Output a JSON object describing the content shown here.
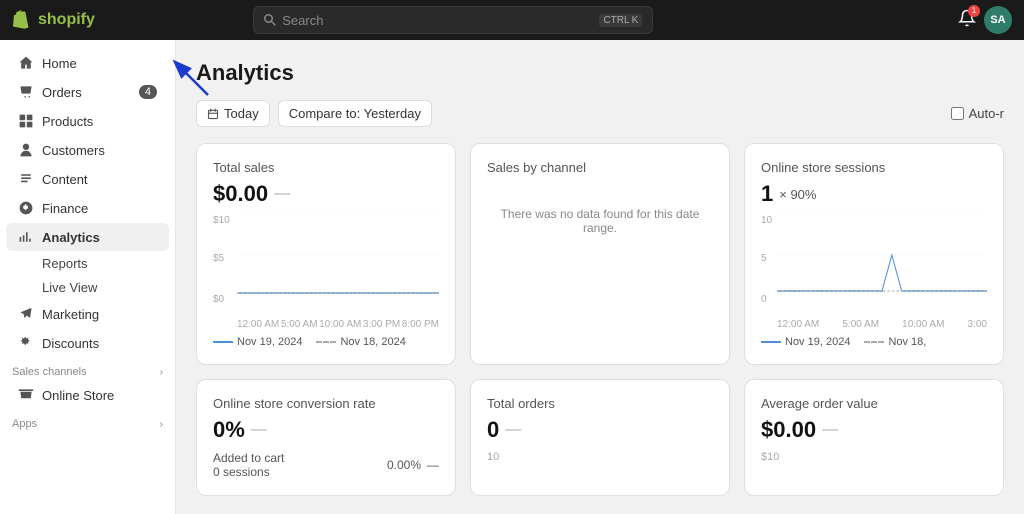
{
  "topbar": {
    "logo_text": "shopify",
    "search_placeholder": "Search",
    "kbd_ctrl": "CTRL",
    "kbd_k": "K",
    "notif_count": "1",
    "avatar_text": "SA"
  },
  "sidebar": {
    "items": [
      {
        "id": "home",
        "label": "Home",
        "icon": "home"
      },
      {
        "id": "orders",
        "label": "Orders",
        "icon": "orders",
        "badge": "4"
      },
      {
        "id": "products",
        "label": "Products",
        "icon": "products"
      },
      {
        "id": "customers",
        "label": "Customers",
        "icon": "customers"
      },
      {
        "id": "content",
        "label": "Content",
        "icon": "content"
      },
      {
        "id": "finance",
        "label": "Finance",
        "icon": "finance"
      },
      {
        "id": "analytics",
        "label": "Analytics",
        "icon": "analytics",
        "active": true
      },
      {
        "id": "marketing",
        "label": "Marketing",
        "icon": "marketing"
      },
      {
        "id": "discounts",
        "label": "Discounts",
        "icon": "discounts"
      }
    ],
    "analytics_sub": [
      {
        "id": "reports",
        "label": "Reports"
      },
      {
        "id": "live-view",
        "label": "Live View"
      }
    ],
    "sales_channels_label": "Sales channels",
    "apps_label": "Apps",
    "online_store": "Online Store"
  },
  "page": {
    "title": "Analytics",
    "today_btn": "Today",
    "compare_btn": "Compare to: Yesterday",
    "auto_refresh_label": "Auto-r"
  },
  "cards": [
    {
      "title": "Total sales",
      "value": "$0.00",
      "dash": "—",
      "y_label_top": "$10",
      "y_label_mid": "$5",
      "y_label_bot": "$0",
      "x_labels": [
        "12:00 AM",
        "5:00 AM",
        "10:00 AM",
        "3:00 PM",
        "8:00 PM"
      ],
      "legend": [
        {
          "label": "Nov 19, 2024",
          "type": "solid"
        },
        {
          "label": "Nov 18, 2024",
          "type": "dashed"
        }
      ],
      "has_chart": true,
      "no_data": false
    },
    {
      "title": "Sales by channel",
      "value": "",
      "dash": "",
      "no_data": true,
      "no_data_text": "There was no data found for this date range.",
      "has_chart": false
    },
    {
      "title": "Online store sessions",
      "value": "1",
      "sub": "× 90%",
      "y_label_top": "10",
      "y_label_mid": "5",
      "y_label_bot": "0",
      "x_labels": [
        "12:00 AM",
        "5:00 AM",
        "10:00 AM",
        "3:00"
      ],
      "legend": [
        {
          "label": "Nov 19, 2024",
          "type": "solid"
        },
        {
          "label": "Nov 18,",
          "type": "dashed"
        }
      ],
      "has_chart": true,
      "no_data": false
    },
    {
      "title": "Online store conversion rate",
      "value": "0%",
      "dash": "—",
      "sub1": "Added to cart",
      "sub2": "0 sessions",
      "sub3": "0.00%",
      "sub4": "—",
      "has_chart": false,
      "no_data": false
    },
    {
      "title": "Total orders",
      "value": "0",
      "dash": "—",
      "y_label_top": "10",
      "has_chart": false,
      "no_data": false
    },
    {
      "title": "Average order value",
      "value": "$0.00",
      "dash": "—",
      "y_label_top": "$10",
      "has_chart": false,
      "no_data": false
    }
  ]
}
